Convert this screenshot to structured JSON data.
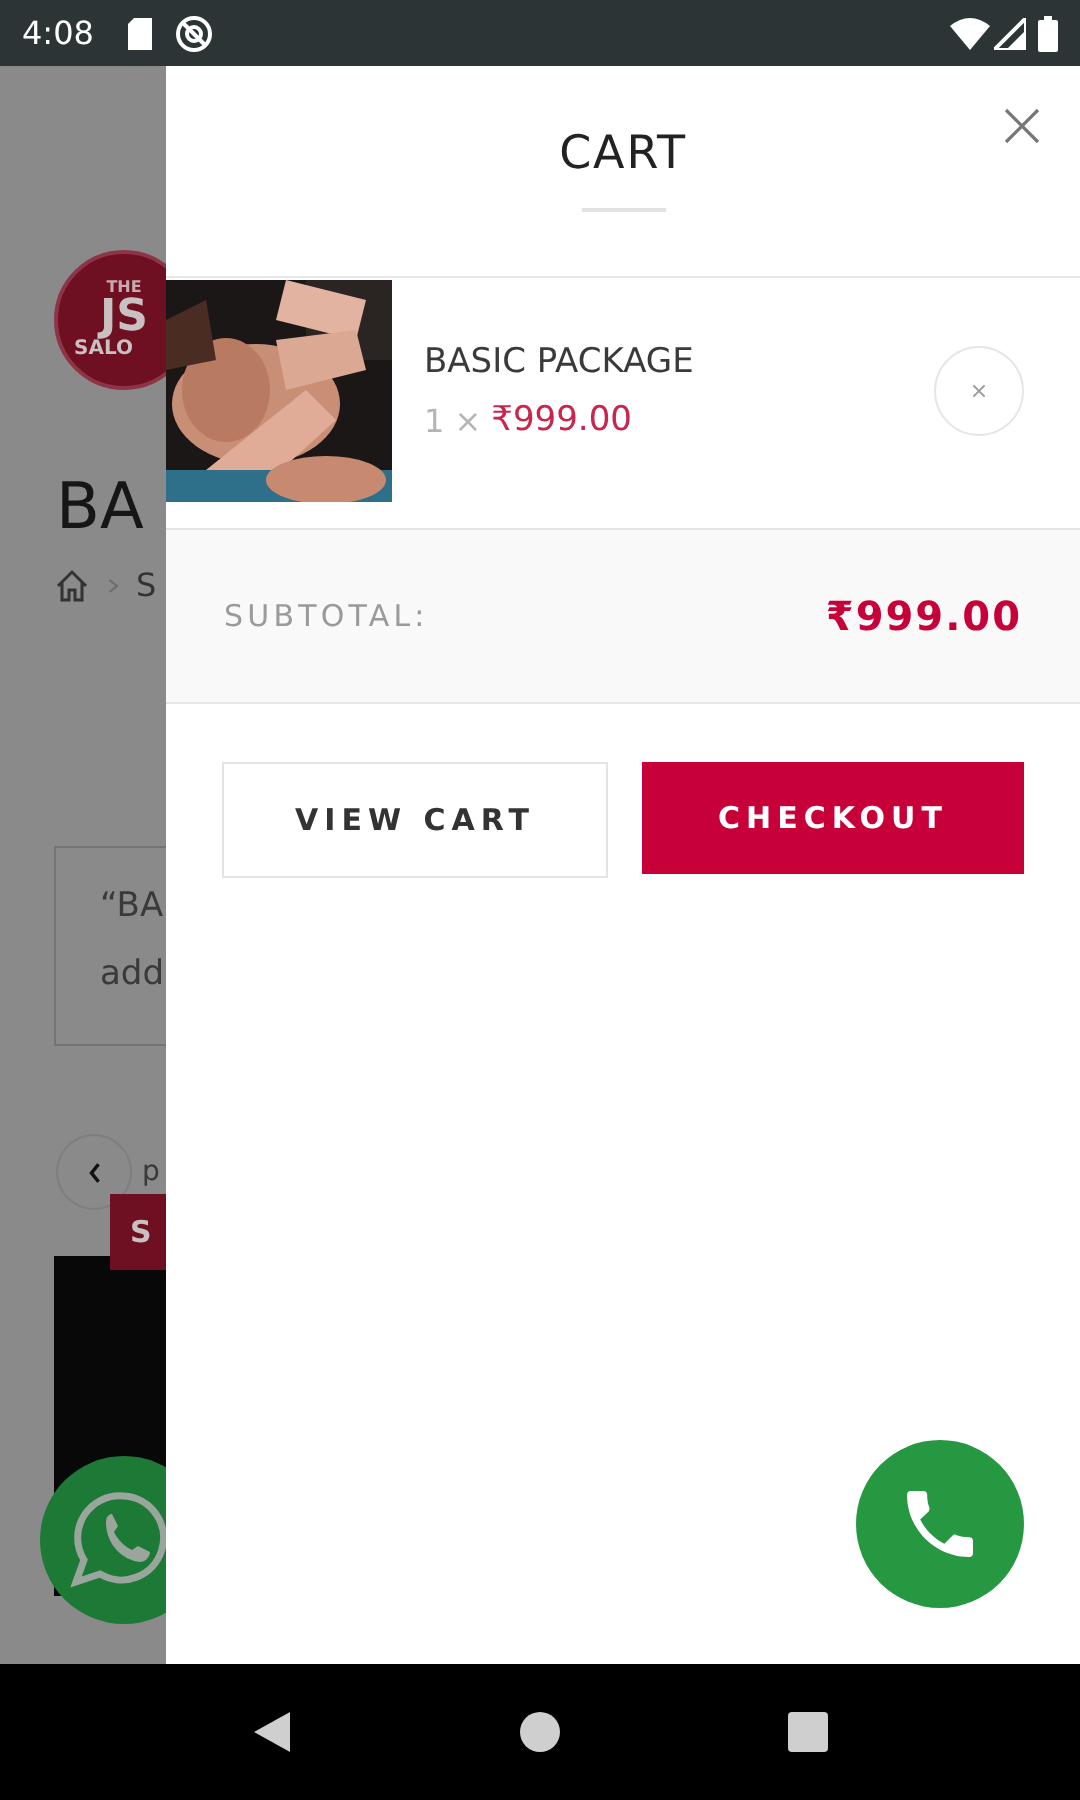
{
  "status_bar": {
    "time": "4:08"
  },
  "background_page": {
    "logo": {
      "top": "THE",
      "main": "JS",
      "bottom": "SALO"
    },
    "title": "BA",
    "breadcrumb": "S",
    "notice_lines": [
      "“BA",
      "add"
    ],
    "pager_label": "p",
    "badge": "S"
  },
  "cart": {
    "title": "CART",
    "items": [
      {
        "name": "BASIC PACKAGE",
        "quantity": "1 ×",
        "price": "₹999.00"
      }
    ],
    "subtotal_label": "SUBTOTAL:",
    "subtotal": "₹999.00",
    "buttons": [
      {
        "label": "VIEW CART",
        "kind": "outline"
      },
      {
        "label": "CHECKOUT",
        "kind": "primary"
      }
    ]
  }
}
